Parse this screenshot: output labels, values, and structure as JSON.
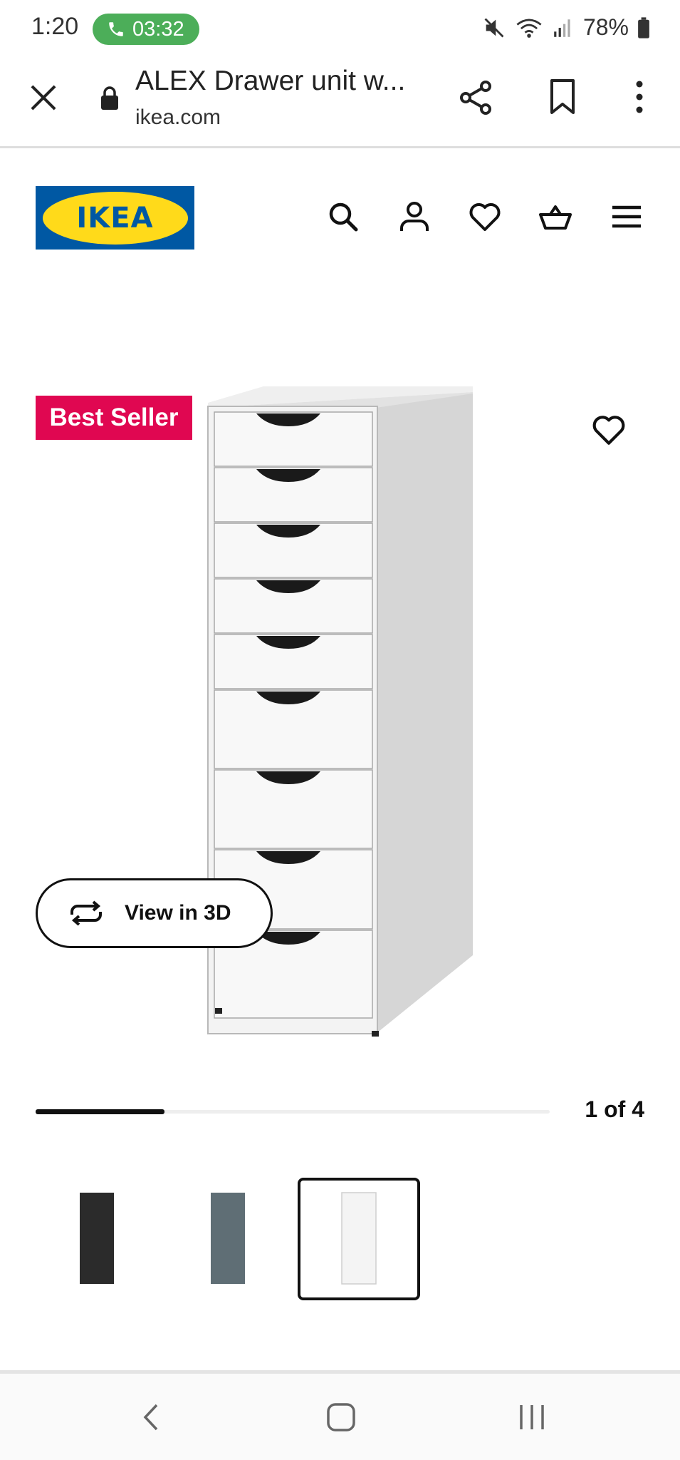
{
  "status_bar": {
    "time": "1:20",
    "call_timer": "03:32",
    "battery": "78%",
    "call_color": "#4cae59"
  },
  "browser": {
    "page_title": "ALEX Drawer unit w...",
    "url": "ikea.com",
    "icons": [
      "close-icon",
      "lock-icon",
      "share-icon",
      "bookmark-icon",
      "more-vert-icon"
    ]
  },
  "header": {
    "logo_text": "IKEA",
    "brand_colors": {
      "blue": "#0058a3",
      "yellow": "#ffda1a"
    },
    "icons": [
      "search-icon",
      "account-icon",
      "favorites-icon",
      "cart-icon",
      "hamburger-menu-icon"
    ]
  },
  "product": {
    "badge": "Best Seller",
    "badge_color": "#e00751",
    "view_3d_label": "View in 3D"
  },
  "gallery": {
    "counter": "1 of 4",
    "progress": 0.25,
    "thumbnails": [
      {
        "color_name": "black-brown",
        "color": "#2b2b2b"
      },
      {
        "color_name": "blue-grey",
        "color": "#5f6e75"
      },
      {
        "color_name": "white",
        "color": "#f4f4f4",
        "selected": true
      }
    ]
  },
  "system_nav": [
    "back-icon",
    "home-icon",
    "recent-apps-icon"
  ]
}
